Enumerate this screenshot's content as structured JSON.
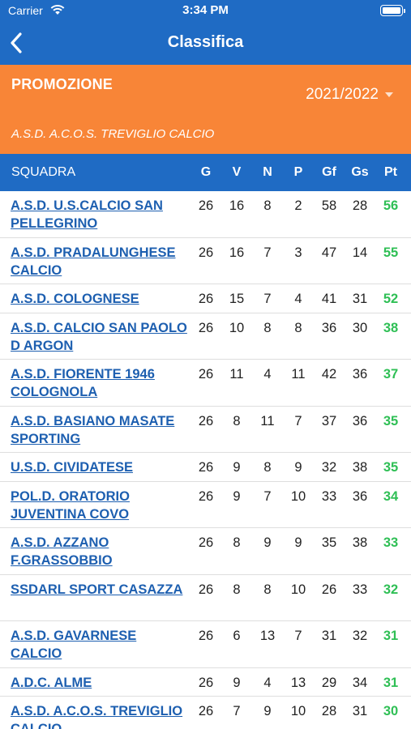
{
  "status": {
    "carrier": "Carrier",
    "time": "3:34 PM"
  },
  "nav": {
    "title": "Classifica"
  },
  "league": {
    "name": "PROMOZIONE",
    "season": "2021/2022",
    "team": "A.S.D. A.C.O.S. TREVIGLIO CALCIO"
  },
  "table": {
    "headers": {
      "team": "SQUADRA",
      "g": "G",
      "v": "V",
      "n": "N",
      "p": "P",
      "gf": "Gf",
      "gs": "Gs",
      "pt": "Pt"
    },
    "rows": [
      {
        "team": "A.S.D. U.S.CALCIO SAN PELLEGRINO",
        "g": "26",
        "v": "16",
        "n": "8",
        "p": "2",
        "gf": "58",
        "gs": "28",
        "pt": "56"
      },
      {
        "team": "A.S.D. PRADALUNGHESE CALCIO",
        "g": "26",
        "v": "16",
        "n": "7",
        "p": "3",
        "gf": "47",
        "gs": "14",
        "pt": "55"
      },
      {
        "team": "A.S.D. COLOGNESE",
        "g": "26",
        "v": "15",
        "n": "7",
        "p": "4",
        "gf": "41",
        "gs": "31",
        "pt": "52"
      },
      {
        "team": "A.S.D. CALCIO SAN PAOLO D ARGON",
        "g": "26",
        "v": "10",
        "n": "8",
        "p": "8",
        "gf": "36",
        "gs": "30",
        "pt": "38"
      },
      {
        "team": "A.S.D. FIORENTE 1946 COLOGNOLA",
        "g": "26",
        "v": "11",
        "n": "4",
        "p": "11",
        "gf": "42",
        "gs": "36",
        "pt": "37"
      },
      {
        "team": "A.S.D. BASIANO MASATE SPORTING",
        "g": "26",
        "v": "8",
        "n": "11",
        "p": "7",
        "gf": "37",
        "gs": "36",
        "pt": "35"
      },
      {
        "team": "U.S.D. CIVIDATESE",
        "g": "26",
        "v": "9",
        "n": "8",
        "p": "9",
        "gf": "32",
        "gs": "38",
        "pt": "35"
      },
      {
        "team": "POL.D. ORATORIO JUVENTINA COVO",
        "g": "26",
        "v": "9",
        "n": "7",
        "p": "10",
        "gf": "33",
        "gs": "36",
        "pt": "34"
      },
      {
        "team": "A.S.D. AZZANO F.GRASSOBBIO",
        "g": "26",
        "v": "8",
        "n": "9",
        "p": "9",
        "gf": "35",
        "gs": "38",
        "pt": "33"
      },
      {
        "team": "SSDARL SPORT CASAZZA",
        "g": "26",
        "v": "8",
        "n": "8",
        "p": "10",
        "gf": "26",
        "gs": "33",
        "pt": "32"
      },
      {
        "team": "A.S.D. GAVARNESE CALCIO",
        "g": "26",
        "v": "6",
        "n": "13",
        "p": "7",
        "gf": "31",
        "gs": "32",
        "pt": "31"
      },
      {
        "team": "A.D.C. ALME",
        "g": "26",
        "v": "9",
        "n": "4",
        "p": "13",
        "gf": "29",
        "gs": "34",
        "pt": "31"
      },
      {
        "team": "A.S.D. A.C.O.S. TREVIGLIO CALCIO",
        "g": "26",
        "v": "7",
        "n": "9",
        "p": "10",
        "gf": "28",
        "gs": "31",
        "pt": "30"
      }
    ]
  },
  "colors": {
    "primary": "#1f6bc4",
    "accent": "#f88537",
    "points": "#2fbf55",
    "link": "#1d5fb0"
  },
  "icons": {
    "back": "chevron-left-icon",
    "wifi": "wifi-icon",
    "battery": "battery-icon",
    "dropdown": "caret-down-icon"
  }
}
